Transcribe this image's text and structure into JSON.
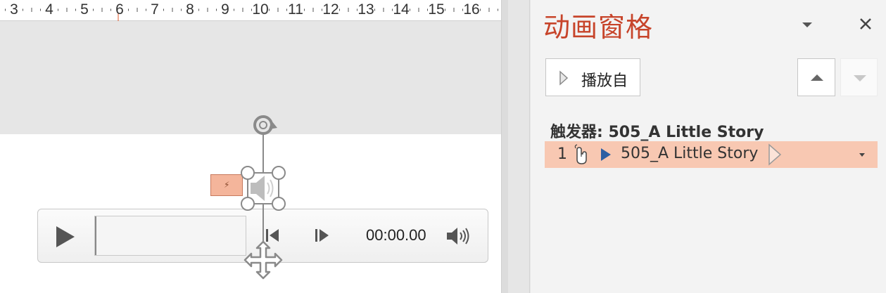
{
  "ruler": {
    "numbers": [
      "3",
      "4",
      "5",
      "6",
      "7",
      "8",
      "9",
      "10",
      "11",
      "12",
      "13",
      "14",
      "15",
      "16"
    ]
  },
  "player": {
    "time": "00:00.00",
    "icons": {
      "play": "play-icon",
      "prev_frame": "step-back-icon",
      "next_frame": "step-forward-icon",
      "volume": "volume-icon"
    }
  },
  "selection": {
    "trigger_tag_glyph": "⚡",
    "icons": {
      "rotate": "rotate-handle-icon",
      "move": "move-handle-icon",
      "audio": "speaker-icon"
    }
  },
  "animation_pane": {
    "title": "动画窗格",
    "play_from_label": "播放自",
    "trigger_header": "触发器: 505_A Little Story",
    "items": [
      {
        "index": "1",
        "name": "505_A Little Story",
        "trigger": "mouse-click-icon",
        "effect": "media-play-icon"
      }
    ]
  },
  "colors": {
    "pane_title": "#c7442a",
    "selected_row": "#f8c8b2",
    "trigger_tag": "#f4b59b",
    "effect_triangle": "#2d5fa3"
  }
}
